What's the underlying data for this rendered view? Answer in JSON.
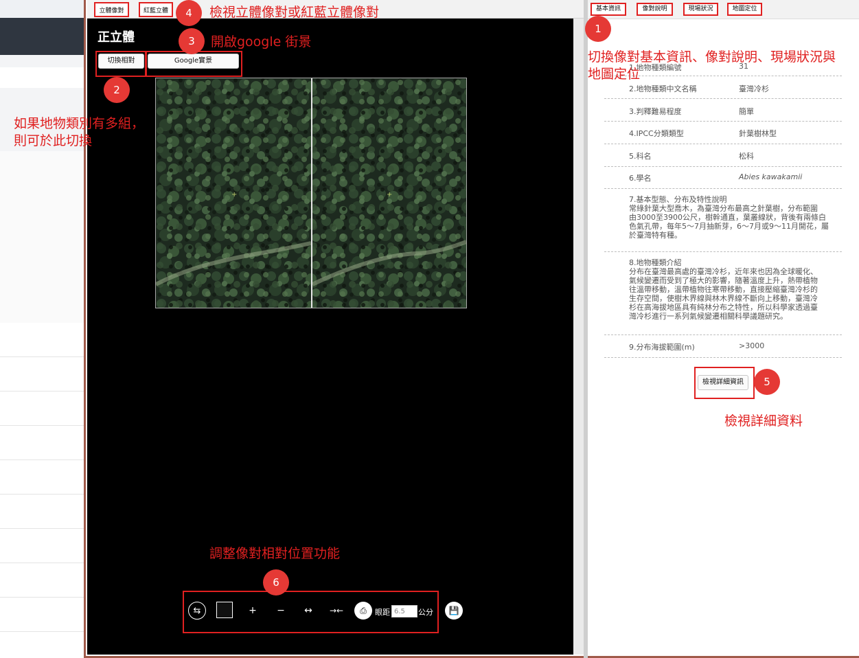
{
  "left_tabs": [
    "立體像對",
    "紅藍立體"
  ],
  "viewer": {
    "title": "正立體",
    "switch_button": "切換相對",
    "google_button": "Google實景"
  },
  "toolbar": {
    "distance_label": "眼距",
    "distance_value": "6.5",
    "distance_unit": "公分"
  },
  "annotations": {
    "a1_num": "1",
    "a2_num": "2",
    "a3_num": "3",
    "a4_num": "4",
    "a5_num": "5",
    "a6_num": "6",
    "a4_text": "檢視立體像對或紅藍立體像對",
    "a3_text": "開啟google 街景",
    "a2_text_line1": "如果地物類別有多組，",
    "a2_text_line2": "則可於此切換",
    "a1_text_line1": "切換像對基本資訊、像對說明、現場狀況與",
    "a1_text_line2": "地圖定位",
    "a5_text": "檢視詳細資料",
    "a6_text": "調整像對相對位置功能"
  },
  "right_tabs": [
    "基本資訊",
    "像對說明",
    "現場狀況",
    "地圖定位"
  ],
  "info": [
    {
      "label": "1.地物種類編號",
      "value": "31"
    },
    {
      "label": "2.地物種類中文名稱",
      "value": "臺灣冷杉"
    },
    {
      "label": "3.判釋難易程度",
      "value": "簡單"
    },
    {
      "label": "4.IPCC分類類型",
      "value": "針葉樹林型"
    },
    {
      "label": "5.科名",
      "value": "松科"
    },
    {
      "label": "6.學名",
      "value": "Abies kawakamii"
    }
  ],
  "desc7": {
    "title": "7.基本型態、分布及特性說明",
    "lines": [
      "常綠針葉大型喬木，為臺灣分布最高之針葉樹，分布範圍",
      "由3000至3900公尺，樹幹通直，葉叢線狀，背後有兩條白",
      "色氣孔帶，每年5～7月抽新芽，6～7月或9～11月開花，屬",
      "於臺灣特有種。"
    ]
  },
  "desc8": {
    "title": "8.地物種類介紹",
    "lines": [
      "分布在臺灣最高處的臺灣冷杉，近年來也因為全球暖化、",
      "氣候變遷而受到了極大的影響，隨著溫度上升，熱帶植物",
      "往溫帶移動，溫帶植物往寒帶移動，直接壓縮臺灣冷杉的",
      "生存空間，使樹木界線與林木界線不斷向上移動，臺灣冷",
      "杉在高海拔地區具有純林分布之特性，所以科學家透過臺",
      "灣冷杉進行一系列氣候變遷相關科學議題研究。"
    ]
  },
  "info9": {
    "label": "9.分布海拔範圍(m)",
    "value": ">3000"
  },
  "detail_button": "檢視詳細資訊"
}
